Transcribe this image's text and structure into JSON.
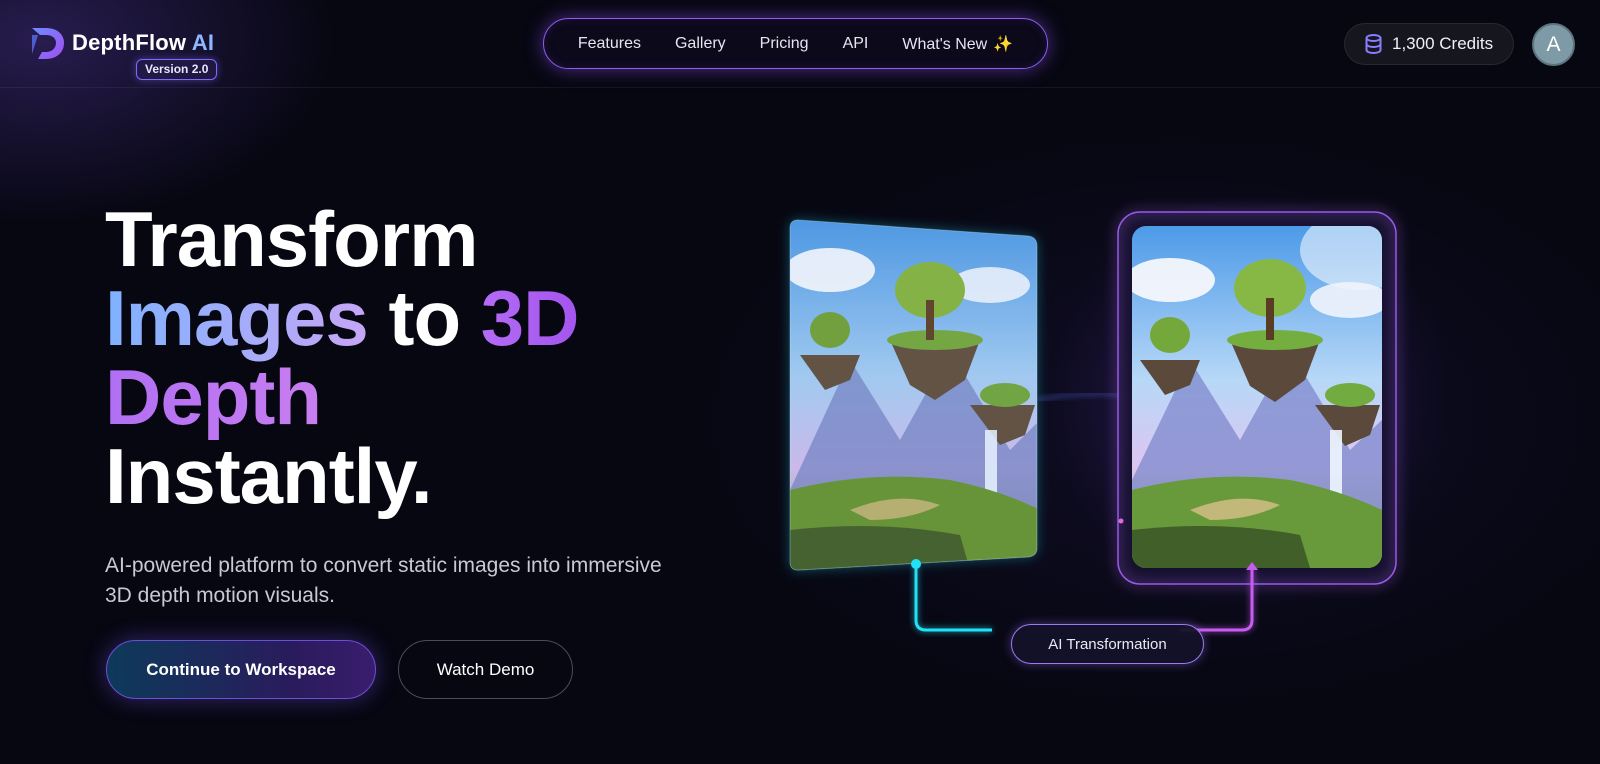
{
  "brand": {
    "name": "DepthFlow",
    "name_suffix": "AI",
    "version": "Version 2.0",
    "accent": "#8f5cf0",
    "secondary_accent": "#7fb2ff"
  },
  "nav": {
    "items": [
      {
        "label": "Features"
      },
      {
        "label": "Gallery"
      },
      {
        "label": "Pricing"
      },
      {
        "label": "API"
      },
      {
        "label": "What's New",
        "icon": "sparkle-icon",
        "glyph": "✨"
      }
    ]
  },
  "account": {
    "credits_label": "1,300 Credits",
    "credits_icon": "database-icon",
    "avatar_initial": "A"
  },
  "hero": {
    "line1": "Transform",
    "line2_a": "Images",
    "line2_b": " to ",
    "line2_c": "3D",
    "line3": "Depth",
    "line4": "Instantly.",
    "subtitle": "AI-powered platform to convert static images into immersive 3D depth motion visuals.",
    "primary_button": "Continue to Workspace",
    "secondary_button": "Watch Demo"
  },
  "visual": {
    "before_image": "floating-islands-landscape-2d",
    "after_image": "floating-islands-landscape-3d",
    "connector_label": "AI Transformation",
    "cyan": "#22e0f5",
    "magenta": "#c95cf0"
  }
}
